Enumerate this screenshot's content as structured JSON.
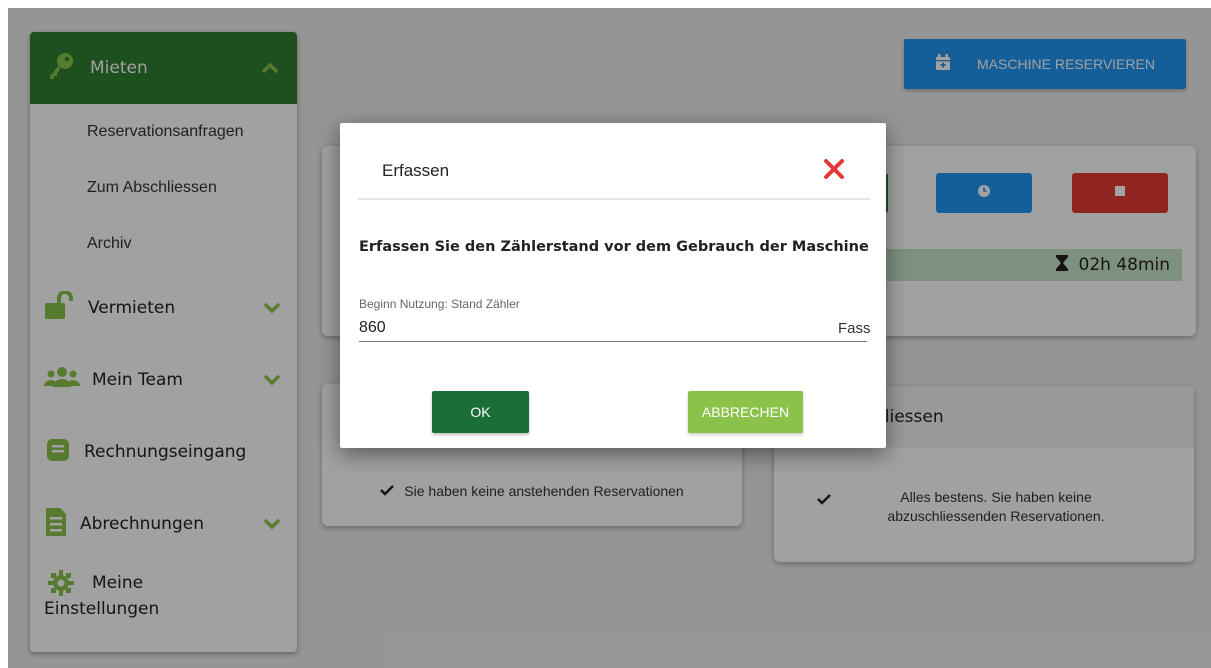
{
  "sidebar": {
    "mieten": {
      "label": "Mieten",
      "icon": "key-icon"
    },
    "sub_items": [
      {
        "label": "Reservationsanfragen"
      },
      {
        "label": "Zum Abschliessen"
      },
      {
        "label": "Archiv"
      }
    ],
    "items": [
      {
        "label": "Vermieten",
        "icon": "unlock-icon"
      },
      {
        "label": "Mein Team",
        "icon": "users-icon"
      },
      {
        "label": "Rechnungseingang",
        "icon": "inbox-icon"
      },
      {
        "label": "Abrechnungen",
        "icon": "document-icon"
      },
      {
        "label": "Meine Einstellungen",
        "icon": "gear-icon"
      }
    ]
  },
  "header": {
    "reserve_label": "MASCHINE RESERVIEREN",
    "reserve_icon": "calendar-icon"
  },
  "machine_card": {
    "timer": "02h 48min",
    "timer_icon": "hourglass-icon"
  },
  "pending_card": {
    "empty_text": "Sie haben keine anstehenden Reservationen"
  },
  "close_card": {
    "title_fragment": "hliessen",
    "empty_text": "Alles bestens. Sie haben keine abzuschliessenden Reservationen."
  },
  "dialog": {
    "title": "Erfassen",
    "question": "Erfassen Sie den Zählerstand vor dem Gebrauch der Maschine",
    "field_label": "Beginn Nutzung: Stand Zähler",
    "field_value": "860",
    "unit": "Fass",
    "ok_label": "OK",
    "cancel_label": "ABBRECHEN"
  },
  "colors": {
    "sidebar_active": "#2e7d32",
    "accent_green": "#7cb342",
    "primary_blue": "#2196f3",
    "danger_red": "#e53935",
    "ok_green": "#1b6e38",
    "cancel_green": "#8bc34a"
  }
}
